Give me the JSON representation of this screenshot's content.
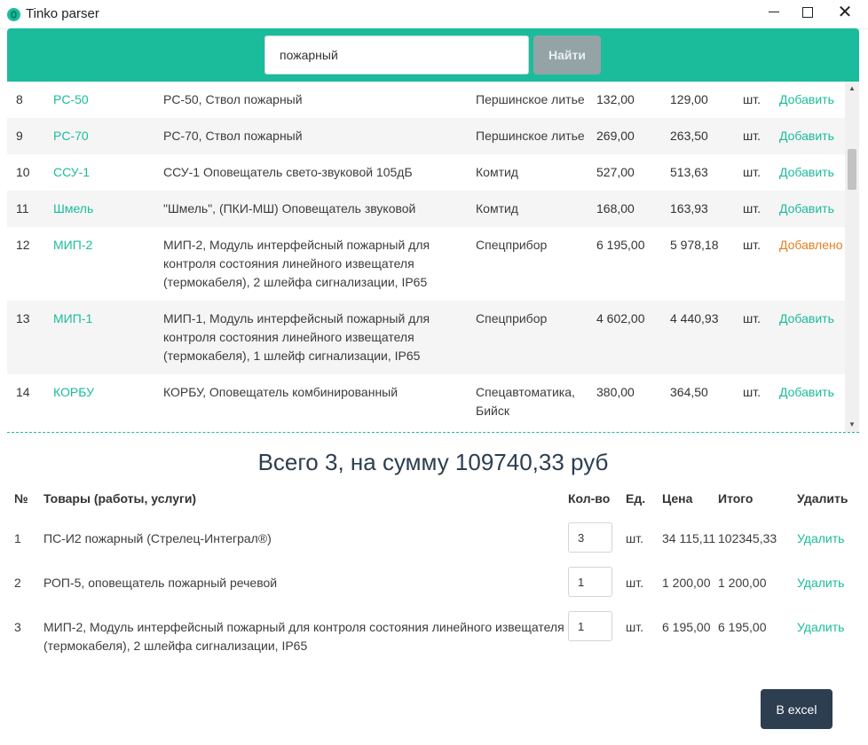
{
  "window": {
    "title": "Tinko parser",
    "close_glyph": "✕"
  },
  "search": {
    "value": "пожарный",
    "button_label": "Найти"
  },
  "products": [
    {
      "num": "8",
      "code": "PC-50",
      "name": "PC-50, Ствол пожарный",
      "maker": "Першинское литье",
      "price1": "132,00",
      "price2": "129,00",
      "unit": "шт.",
      "action": "Добавить",
      "added": false
    },
    {
      "num": "9",
      "code": "PC-70",
      "name": "PC-70, Ствол пожарный",
      "maker": "Першинское литье",
      "price1": "269,00",
      "price2": "263,50",
      "unit": "шт.",
      "action": "Добавить",
      "added": false
    },
    {
      "num": "10",
      "code": "ССУ-1",
      "name": "ССУ-1 Оповещатель свето-звуковой 105дБ",
      "maker": "Комтид",
      "price1": "527,00",
      "price2": "513,63",
      "unit": "шт.",
      "action": "Добавить",
      "added": false
    },
    {
      "num": "11",
      "code": "Шмель",
      "name": "\"Шмель\", (ПКИ-МШ) Оповещатель звуковой",
      "maker": "Комтид",
      "price1": "168,00",
      "price2": "163,93",
      "unit": "шт.",
      "action": "Добавить",
      "added": false
    },
    {
      "num": "12",
      "code": "МИП-2",
      "name": "МИП-2, Модуль интерфейсный пожарный для контроля состояния линейного извещателя (термокабеля), 2 шлейфа сигнализации, IP65",
      "maker": "Спецприбор",
      "price1": "6 195,00",
      "price2": "5 978,18",
      "unit": "шт.",
      "action": "Добавлено",
      "added": true
    },
    {
      "num": "13",
      "code": "МИП-1",
      "name": "МИП-1, Модуль интерфейсный пожарный для контроля состояния линейного извещателя (термокабеля), 1 шлейф сигнализации, IP65",
      "maker": "Спецприбор",
      "price1": "4 602,00",
      "price2": "4 440,93",
      "unit": "шт.",
      "action": "Добавить",
      "added": false
    },
    {
      "num": "14",
      "code": "КОРБУ",
      "name": "КОРБУ, Оповещатель комбинированный",
      "maker": "Спецавтоматика, Бийск",
      "price1": "380,00",
      "price2": "364,50",
      "unit": "шт.",
      "action": "Добавить",
      "added": false
    }
  ],
  "cart": {
    "summary": "Всего 3, на сумму 109740,33 руб",
    "headers": {
      "num": "№",
      "name": "Товары (работы, услуги)",
      "qty": "Кол-во",
      "unit": "Ед.",
      "price": "Цена",
      "total": "Итого",
      "delete": "Удалить"
    },
    "items": [
      {
        "num": "1",
        "name": "ПС-И2 пожарный (Стрелец-Интеграл®)",
        "qty": "3",
        "unit": "шт.",
        "price": "34 115,11",
        "total": "102345,33",
        "delete": "Удалить"
      },
      {
        "num": "2",
        "name": "РОП-5, оповещатель пожарный речевой",
        "qty": "1",
        "unit": "шт.",
        "price": "1 200,00",
        "total": "1 200,00",
        "delete": "Удалить"
      },
      {
        "num": "3",
        "name": "МИП-2, Модуль интерфейсный пожарный для контроля состояния линейного извещателя (термокабеля), 2 шлейфа сигнализации, IP65",
        "qty": "1",
        "unit": "шт.",
        "price": "6 195,00",
        "total": "6 195,00",
        "delete": "Удалить"
      }
    ],
    "excel_label": "В excel"
  },
  "colors": {
    "accent": "#1abc9c",
    "added": "#e67e22",
    "dark": "#2c3e50"
  }
}
